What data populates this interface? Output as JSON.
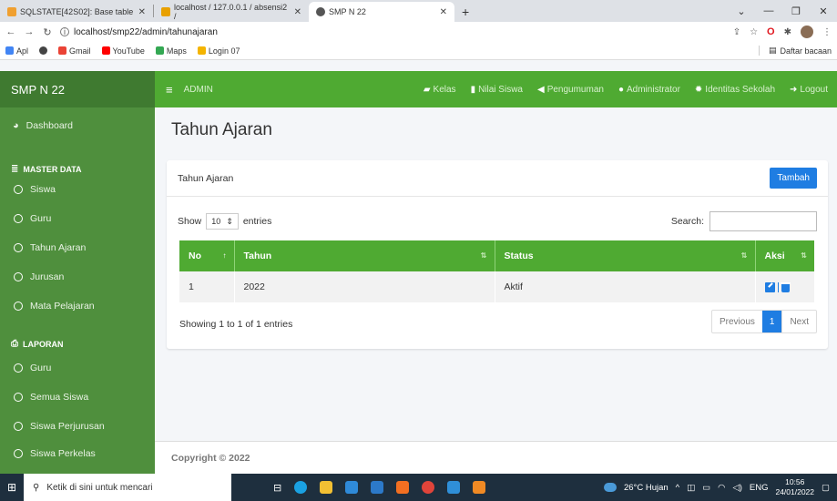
{
  "browser": {
    "tabs": [
      {
        "title": "SQLSTATE[42S02]: Base table",
        "favicon_color": "#f0a030"
      },
      {
        "title": "localhost / 127.0.0.1 / absensi2 /",
        "favicon_color": "#e8a000"
      },
      {
        "title": "SMP N 22",
        "favicon_color": "#555555"
      }
    ],
    "new_tab": "+",
    "url": "localhost/smp22/admin/tahunajaran",
    "bookmarks": [
      {
        "label": "Apl",
        "color": "#4285f4"
      },
      {
        "label": "",
        "color": "#444444"
      },
      {
        "label": "Gmail",
        "color": "#ea4335"
      },
      {
        "label": "YouTube",
        "color": "#ff0000"
      },
      {
        "label": "Maps",
        "color": "#34a853"
      },
      {
        "label": "Login 07",
        "color": "#f4b400"
      }
    ],
    "reading_list": "Daftar bacaan"
  },
  "app": {
    "brand": "SMP N 22",
    "top_left_label": "ADMIN",
    "nav": [
      {
        "label": "Kelas",
        "icon": "folder-icon"
      },
      {
        "label": "Nilai Siswa",
        "icon": "file-icon"
      },
      {
        "label": "Pengumuman",
        "icon": "megaphone-icon"
      },
      {
        "label": "Administrator",
        "icon": "user-icon"
      },
      {
        "label": "Identitas Sekolah",
        "icon": "gear-icon"
      },
      {
        "label": "Logout",
        "icon": "sign-out-icon"
      }
    ],
    "sidebar": {
      "dashboard": "Dashboard",
      "master_head": "MASTER DATA",
      "master_items": [
        "Siswa",
        "Guru",
        "Tahun Ajaran",
        "Jurusan",
        "Mata Pelajaran"
      ],
      "report_head": "LAPORAN",
      "report_items": [
        "Guru",
        "Semua Siswa",
        "Siswa Perjurusan",
        "Siswa Perkelas"
      ]
    },
    "page_title": "Tahun Ajaran",
    "card": {
      "title": "Tahun Ajaran",
      "add_button": "Tambah",
      "show": "Show",
      "entries_value": "10",
      "entries": "entries",
      "search_label": "Search:",
      "columns": [
        "No",
        "Tahun",
        "Status",
        "Aksi"
      ],
      "rows": [
        {
          "no": "1",
          "tahun": "2022",
          "status": "Aktif"
        }
      ],
      "info": "Showing 1 to 1 of 1 entries",
      "pager": {
        "prev": "Previous",
        "page": "1",
        "next": "Next"
      }
    },
    "footer": "Copyright © 2022"
  },
  "taskbar": {
    "search_placeholder": "Ketik di sini untuk mencari",
    "weather": "26°C Hujan",
    "lang": "ENG",
    "time": "10:56",
    "date": "24/01/2022"
  }
}
